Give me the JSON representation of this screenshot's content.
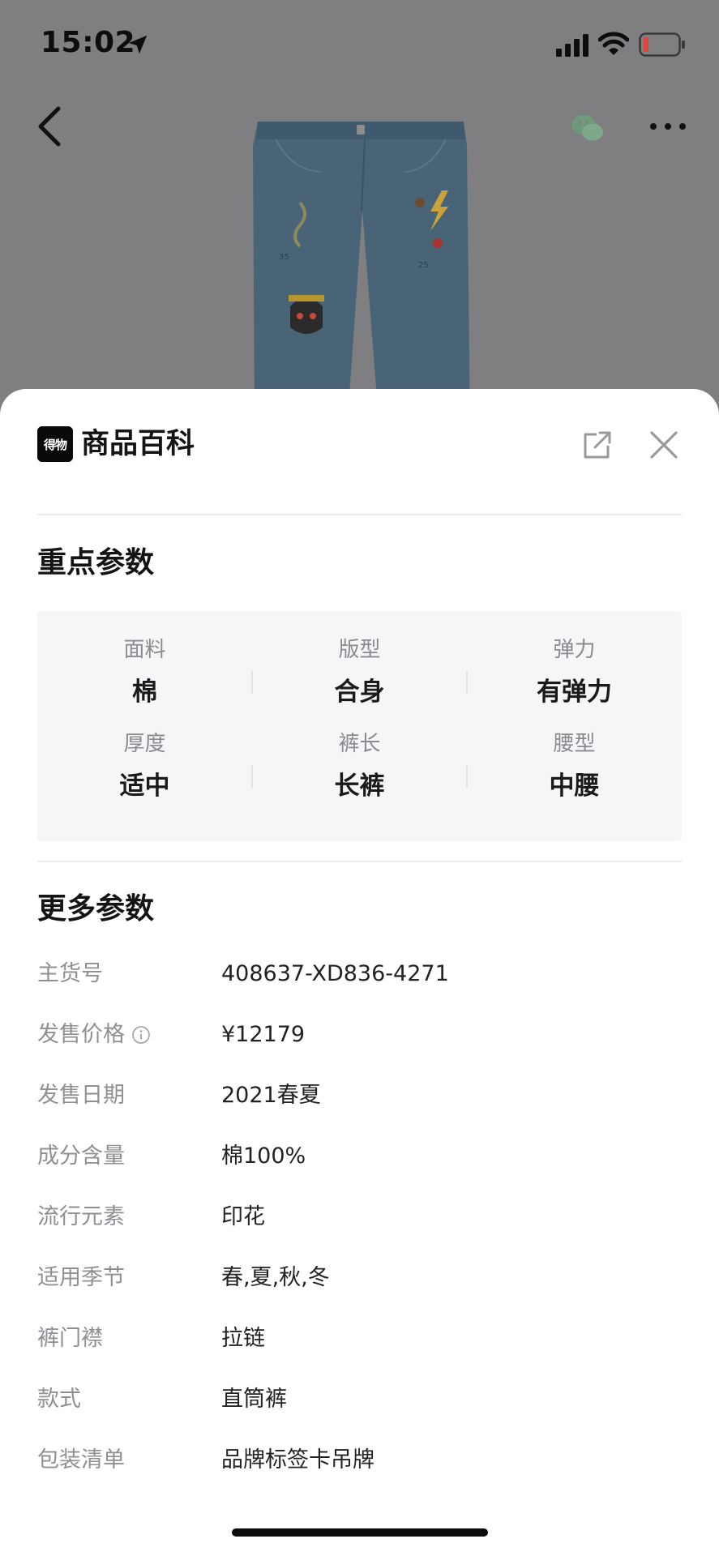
{
  "status_bar": {
    "time": "15:02",
    "icons": [
      "location-arrow-icon",
      "cellular-signal-icon",
      "wifi-icon",
      "battery-low-icon"
    ]
  },
  "nav": {
    "icons": [
      "back-chevron-icon",
      "wechat-icon",
      "more-dots-icon"
    ]
  },
  "sheet": {
    "brand_logo_text": "得物",
    "title": "商品百科",
    "header_icons": [
      "share-external-icon",
      "close-x-icon"
    ],
    "key_params": {
      "title": "重点参数",
      "items": [
        {
          "label": "面料",
          "value": "棉"
        },
        {
          "label": "版型",
          "value": "合身"
        },
        {
          "label": "弹力",
          "value": "有弹力"
        },
        {
          "label": "厚度",
          "value": "适中"
        },
        {
          "label": "裤长",
          "value": "长裤"
        },
        {
          "label": "腰型",
          "value": "中腰"
        }
      ]
    },
    "more_params": {
      "title": "更多参数",
      "rows": [
        {
          "label": "主货号",
          "value": "408637-XD836-4271"
        },
        {
          "label": "发售价格",
          "value": "¥12179",
          "has_info_icon": true
        },
        {
          "label": "发售日期",
          "value": "2021春夏"
        },
        {
          "label": "成分含量",
          "value": "棉100%"
        },
        {
          "label": "流行元素",
          "value": "印花"
        },
        {
          "label": "适用季节",
          "value": "春,夏,秋,冬"
        },
        {
          "label": "裤门襟",
          "value": "拉链"
        },
        {
          "label": "款式",
          "value": "直筒裤"
        },
        {
          "label": "包装清单",
          "value": "品牌标签卡吊牌"
        }
      ]
    }
  },
  "colors": {
    "overlay_bg": "#7f7f81",
    "sheet_bg": "#ffffff",
    "panel_bg": "#f6f6f8",
    "label_gray": "#8f8f94",
    "text_dark": "#1a1a1a",
    "battery_red": "#e0443a",
    "denim": "#4a6477"
  }
}
